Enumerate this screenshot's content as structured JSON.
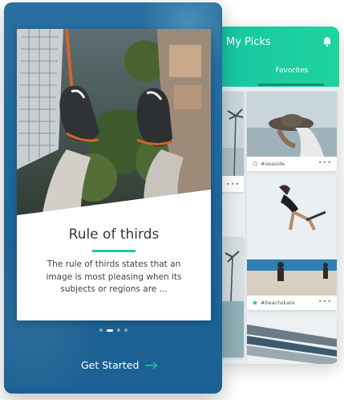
{
  "back_app": {
    "title": "My Picks",
    "tab_label": "Favorites",
    "cards": [
      {
        "tag": "#seaside"
      },
      {
        "tag": "#beachskate"
      }
    ],
    "more_label": "•••"
  },
  "onboarding": {
    "title": "Rule of thirds",
    "body": "The rule of thirds states that an image is most pleasing when its subjects or regions are ...",
    "pager": {
      "current": 2,
      "total": 4
    },
    "cta_label": "Get Started"
  },
  "colors": {
    "accent": "#1dc9a0",
    "front_bg": "#20689a"
  }
}
